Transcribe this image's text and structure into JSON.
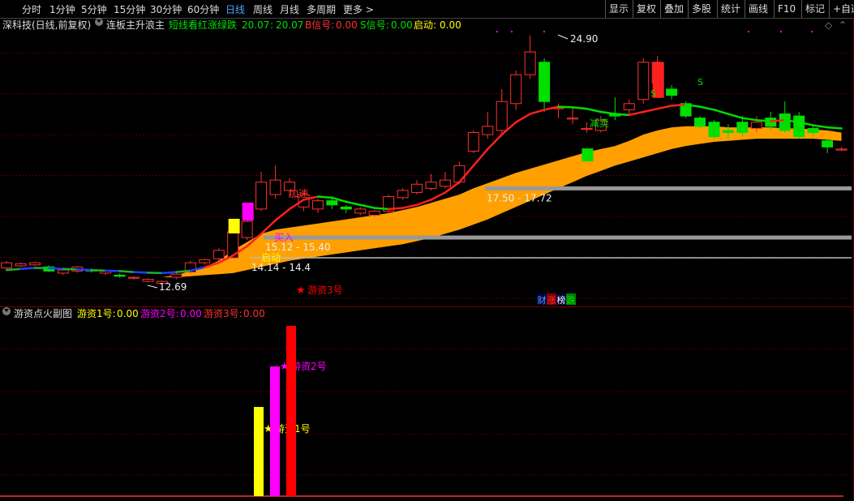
{
  "periods": [
    "分时",
    "1分钟",
    "5分钟",
    "15分钟",
    "30分钟",
    "60分钟",
    "日线",
    "周线",
    "月线",
    "多周期",
    "更多 >"
  ],
  "active_period": "日线",
  "tools": [
    "显示",
    "复权",
    "叠加",
    "多股",
    "统计",
    "画线",
    "F10",
    "标记",
    "+自选"
  ],
  "main_info": {
    "stock": "深科技(日线,前复权)",
    "indicator": "连板主升浪主",
    "desc": "短线看红涨绿跌",
    "v1": "20.07",
    "v2": "20.07",
    "b_label": "B信号:",
    "b_val": "0.00",
    "s_label": "S信号:",
    "s_val": "0.00",
    "q_label": "启动:",
    "q_val": "0.00"
  },
  "sub_info": {
    "name": "游资点火副图",
    "y1_label": "游资1号:",
    "y1_val": "0.00",
    "y2_label": "游资2号:",
    "y2_val": "0.00",
    "y3_label": "游资3号:",
    "y3_val": "0.00"
  },
  "colors": {
    "up": "#ff3030",
    "down": "#00e000",
    "ma_up": "#ff2020",
    "ma_down": "#00dd00",
    "band": "#ffa000",
    "yellow": "#ffff00",
    "magenta": "#ff00ff",
    "red": "#ff0000",
    "grid": "#8b0000"
  },
  "chart_data": {
    "type": "candlestick",
    "price_range": [
      12.0,
      26.0
    ],
    "candles": [
      {
        "o": 13.65,
        "c": 13.9,
        "h": 13.98,
        "l": 13.55
      },
      {
        "o": 13.75,
        "c": 13.85,
        "h": 13.92,
        "l": 13.7
      },
      {
        "o": 13.8,
        "c": 13.9,
        "h": 13.95,
        "l": 13.75
      },
      {
        "o": 13.7,
        "c": 13.5,
        "h": 13.78,
        "l": 13.45
      },
      {
        "o": 13.4,
        "c": 13.55,
        "h": 13.6,
        "l": 13.3
      },
      {
        "o": 13.5,
        "c": 13.7,
        "h": 13.75,
        "l": 13.42
      },
      {
        "o": 13.55,
        "c": 13.5,
        "h": 13.62,
        "l": 13.42
      },
      {
        "o": 13.4,
        "c": 13.5,
        "h": 13.55,
        "l": 13.3
      },
      {
        "o": 13.3,
        "c": 13.25,
        "h": 13.38,
        "l": 13.18
      },
      {
        "o": 13.15,
        "c": 13.2,
        "h": 13.25,
        "l": 13.08
      },
      {
        "o": 13.0,
        "c": 13.1,
        "h": 13.15,
        "l": 12.95
      },
      {
        "o": 12.9,
        "c": 13.0,
        "h": 13.05,
        "l": 12.69
      },
      {
        "o": 13.2,
        "c": 13.35,
        "h": 13.45,
        "l": 13.1
      },
      {
        "o": 13.45,
        "c": 13.9,
        "h": 14.0,
        "l": 13.4
      },
      {
        "o": 13.9,
        "c": 14.05,
        "h": 14.1,
        "l": 13.8
      },
      {
        "o": 14.1,
        "c": 14.5,
        "h": 14.6,
        "l": 14.0
      },
      {
        "o": 14.14,
        "c": 15.4,
        "h": 15.45,
        "l": 14.14
      },
      {
        "o": 15.12,
        "c": 15.9,
        "h": 15.95,
        "l": 15.0
      },
      {
        "o": 16.5,
        "c": 17.8,
        "h": 18.3,
        "l": 16.4
      },
      {
        "o": 17.2,
        "c": 17.9,
        "h": 18.6,
        "l": 17.0
      },
      {
        "o": 17.4,
        "c": 17.8,
        "h": 18.0,
        "l": 17.1
      },
      {
        "o": 16.6,
        "c": 17.2,
        "h": 17.3,
        "l": 16.4
      },
      {
        "o": 16.5,
        "c": 16.9,
        "h": 17.0,
        "l": 16.3
      },
      {
        "o": 16.9,
        "c": 16.7,
        "h": 17.0,
        "l": 16.5
      },
      {
        "o": 16.6,
        "c": 16.5,
        "h": 16.7,
        "l": 16.3
      },
      {
        "o": 16.3,
        "c": 16.5,
        "h": 16.6,
        "l": 16.2
      },
      {
        "o": 16.2,
        "c": 16.4,
        "h": 16.45,
        "l": 16.1
      },
      {
        "o": 16.4,
        "c": 17.1,
        "h": 17.2,
        "l": 16.3
      },
      {
        "o": 17.05,
        "c": 17.4,
        "h": 17.5,
        "l": 16.95
      },
      {
        "o": 17.3,
        "c": 17.7,
        "h": 17.9,
        "l": 17.2
      },
      {
        "o": 17.5,
        "c": 17.8,
        "h": 18.2,
        "l": 17.4
      },
      {
        "o": 17.6,
        "c": 17.9,
        "h": 18.3,
        "l": 17.5
      },
      {
        "o": 17.8,
        "c": 18.6,
        "h": 18.8,
        "l": 17.7
      },
      {
        "o": 19.3,
        "c": 20.2,
        "h": 20.3,
        "l": 19.2
      },
      {
        "o": 20.1,
        "c": 20.5,
        "h": 21.2,
        "l": 19.9
      },
      {
        "o": 20.3,
        "c": 21.7,
        "h": 22.3,
        "l": 20.0
      },
      {
        "o": 21.6,
        "c": 23.0,
        "h": 23.2,
        "l": 21.3
      },
      {
        "o": 23.0,
        "c": 24.1,
        "h": 24.9,
        "l": 22.8
      },
      {
        "o": 23.6,
        "c": 21.7,
        "h": 23.8,
        "l": 21.2
      },
      {
        "o": 21.4,
        "c": 21.4,
        "h": 21.6,
        "l": 20.9
      },
      {
        "o": 20.9,
        "c": 20.9,
        "h": 21.4,
        "l": 20.6
      },
      {
        "o": 20.4,
        "c": 20.4,
        "h": 20.7,
        "l": 20.2
      },
      {
        "o": 20.3,
        "c": 20.8,
        "h": 21.0,
        "l": 20.2
      },
      {
        "o": 21.1,
        "c": 21.0,
        "h": 21.9,
        "l": 20.8
      },
      {
        "o": 21.3,
        "c": 21.6,
        "h": 21.8,
        "l": 21.1
      },
      {
        "o": 21.8,
        "c": 23.6,
        "h": 23.8,
        "l": 21.6
      },
      {
        "o": 22.6,
        "c": 23.6,
        "h": 23.9,
        "l": 22.4
      },
      {
        "o": 22.3,
        "c": 22.0,
        "h": 22.5,
        "l": 21.8
      },
      {
        "o": 21.6,
        "c": 21.0,
        "h": 21.7,
        "l": 20.9
      },
      {
        "o": 20.9,
        "c": 20.5,
        "h": 21.0,
        "l": 20.4
      },
      {
        "o": 20.7,
        "c": 20.0,
        "h": 20.8,
        "l": 19.9
      },
      {
        "o": 20.3,
        "c": 20.2,
        "h": 20.6,
        "l": 19.9
      },
      {
        "o": 20.7,
        "c": 20.2,
        "h": 21.0,
        "l": 20.0
      },
      {
        "o": 20.4,
        "c": 20.7,
        "h": 21.0,
        "l": 20.2
      },
      {
        "o": 20.9,
        "c": 20.5,
        "h": 21.2,
        "l": 20.3
      },
      {
        "o": 21.1,
        "c": 20.3,
        "h": 21.7,
        "l": 20.2
      },
      {
        "o": 21.0,
        "c": 20.0,
        "h": 21.2,
        "l": 19.9
      },
      {
        "o": 20.4,
        "c": 20.2,
        "h": 20.6,
        "l": 20.0
      },
      {
        "o": 19.8,
        "c": 19.5,
        "h": 19.9,
        "l": 19.2
      },
      {
        "o": 19.4,
        "c": 19.4,
        "h": 19.5,
        "l": 19.3
      }
    ],
    "ma": [
      13.55,
      13.6,
      13.65,
      13.64,
      13.6,
      13.58,
      13.55,
      13.52,
      13.5,
      13.45,
      13.42,
      13.4,
      13.45,
      13.52,
      13.68,
      13.9,
      14.25,
      14.7,
      15.3,
      15.95,
      16.5,
      16.95,
      17.1,
      17.05,
      16.85,
      16.7,
      16.55,
      16.5,
      16.55,
      16.7,
      16.95,
      17.3,
      17.8,
      18.6,
      19.4,
      20.1,
      20.7,
      21.1,
      21.3,
      21.45,
      21.42,
      21.35,
      21.2,
      21.1,
      21.05,
      21.2,
      21.35,
      21.5,
      21.55,
      21.45,
      21.3,
      21.1,
      20.9,
      20.8,
      20.75,
      20.8,
      20.7,
      20.55,
      20.45,
      20.4
    ],
    "band_upper": [
      13.2,
      13.2,
      13.2,
      13.2,
      13.2,
      13.2,
      13.2,
      13.2,
      13.2,
      13.2,
      13.2,
      13.2,
      13.3,
      13.5,
      13.7,
      14.0,
      14.5,
      14.9,
      15.3,
      15.5,
      15.6,
      15.7,
      15.8,
      15.9,
      16.0,
      16.1,
      16.2,
      16.3,
      16.45,
      16.6,
      16.8,
      17.0,
      17.2,
      17.5,
      17.75,
      18.0,
      18.25,
      18.45,
      18.65,
      18.85,
      19.05,
      19.25,
      19.4,
      19.55,
      19.8,
      20.1,
      20.3,
      20.45,
      20.5,
      20.5,
      20.5,
      20.45,
      20.45,
      20.45,
      20.45,
      20.4,
      20.4,
      20.35,
      20.3,
      20.2
    ],
    "band_lower": [
      13.2,
      13.2,
      13.2,
      13.2,
      13.2,
      13.2,
      13.2,
      13.2,
      13.2,
      13.2,
      13.2,
      13.2,
      13.2,
      13.25,
      13.3,
      13.35,
      13.4,
      13.55,
      13.7,
      13.85,
      14.0,
      14.1,
      14.2,
      14.3,
      14.4,
      14.5,
      14.6,
      14.7,
      14.8,
      14.95,
      15.1,
      15.3,
      15.5,
      15.75,
      16.0,
      16.3,
      16.6,
      16.9,
      17.2,
      17.5,
      17.8,
      18.1,
      18.35,
      18.6,
      18.8,
      19.0,
      19.2,
      19.4,
      19.55,
      19.65,
      19.75,
      19.8,
      19.85,
      19.9,
      19.9,
      19.9,
      19.9,
      19.9,
      19.85,
      19.8
    ],
    "hlines": [
      {
        "y": 17.5,
        "label": "17.50 - 17.72"
      },
      {
        "y": 15.12,
        "label": "15.12 - 15.40"
      },
      {
        "y": 14.14,
        "label": "14.14 - 14.4"
      }
    ],
    "annotations": {
      "high": "24.90",
      "low": "12.69",
      "add": "加速",
      "start": "启动",
      "buy": "买入",
      "reduce": "减卖",
      "s_marker": "S",
      "rank": [
        "财",
        "涨",
        "榜",
        "跌"
      ]
    },
    "sub_chart": {
      "type": "bar",
      "series": [
        {
          "name": "游资1号",
          "value": 0.55
        },
        {
          "name": "游资2号",
          "value": 0.8
        },
        {
          "name": "游资3号",
          "value": 1.05
        }
      ]
    }
  }
}
